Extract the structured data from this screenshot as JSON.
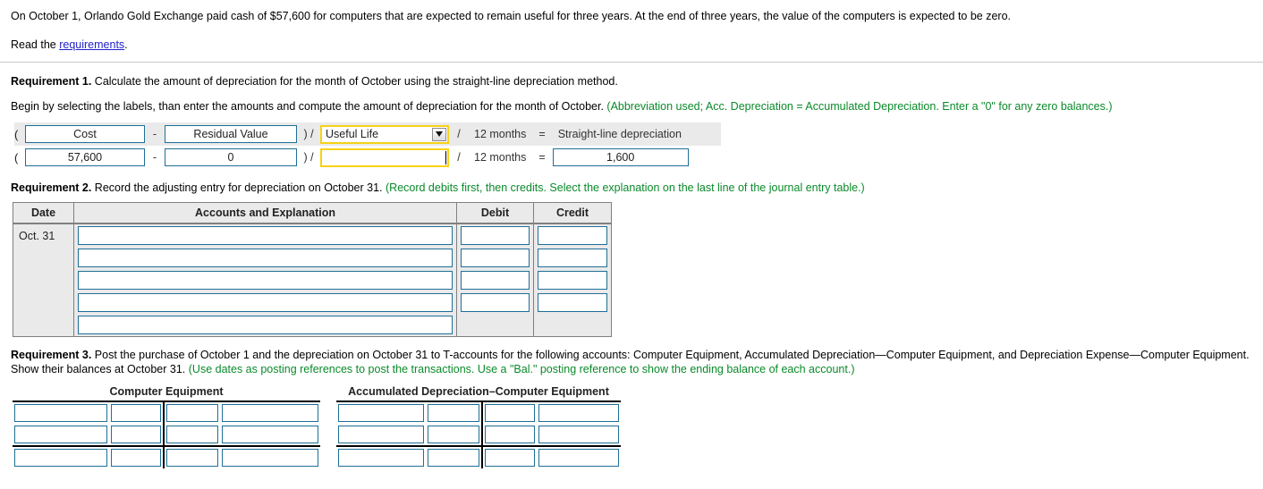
{
  "intro": {
    "paragraph": "On October 1, Orlando Gold Exchange paid cash of $57,600 for computers that are expected to remain useful for three years. At the end of three years, the value of the computers is expected to be zero.",
    "read_prefix": "Read the ",
    "link_text": "requirements",
    "read_suffix": "."
  },
  "requirement1": {
    "label": "Requirement 1.",
    "text": " Calculate the amount of depreciation for the month of October using the straight-line depreciation method.",
    "instruction_label": "Begin by selecting the labels, than enter the amounts and compute the amount of depreciation for the month of October.",
    "instruction_note": "(Abbreviation used; Acc. Depreciation = Accumulated Depreciation. Enter a \"0\" for any zero balances.)",
    "formula": {
      "open_paren": "(",
      "minus": "-",
      "close_paren_divide": ") /",
      "divide": "/",
      "equals": "=",
      "label_cost": "Cost",
      "label_residual": "Residual Value",
      "label_useful_life": "Useful Life",
      "label_months": "12 months",
      "label_result": "Straight-line depreciation",
      "value_cost": "57,600",
      "value_residual": "0",
      "value_useful_life": "",
      "value_months": "12 months",
      "value_result": "1,600"
    }
  },
  "requirement2": {
    "label": "Requirement 2.",
    "text": " Record the adjusting entry for depreciation on October 31.",
    "note": "(Record debits first, then credits. Select the explanation on the last line of the journal entry table.)",
    "table": {
      "headers": [
        "Date",
        "Accounts and Explanation",
        "Debit",
        "Credit"
      ],
      "date": "Oct. 31",
      "rows": [
        {
          "account": "",
          "debit": "",
          "credit": "",
          "has_amounts": true
        },
        {
          "account": "",
          "debit": "",
          "credit": "",
          "has_amounts": true
        },
        {
          "account": "",
          "debit": "",
          "credit": "",
          "has_amounts": true
        },
        {
          "account": "",
          "debit": "",
          "credit": "",
          "has_amounts": true
        },
        {
          "account": "",
          "debit": "",
          "credit": "",
          "has_amounts": false
        }
      ]
    }
  },
  "requirement3": {
    "label": "Requirement 3.",
    "text": " Post the purchase of October 1 and the depreciation on October 31 to T-accounts for the following accounts: Computer Equipment, Accumulated Depreciation—Computer Equipment, and Depreciation Expense—Computer Equipment. Show their balances at October 31.",
    "note": "(Use dates as posting references to post the transactions. Use a \"Bal.\" posting reference to show the ending balance of each account.)",
    "t_accounts": [
      {
        "title": "Computer Equipment",
        "rows": [
          {
            "left_ref": "",
            "left_amt": "",
            "right_amt": "",
            "right_ref": "",
            "is_balance": false
          },
          {
            "left_ref": "",
            "left_amt": "",
            "right_amt": "",
            "right_ref": "",
            "is_balance": false
          },
          {
            "left_ref": "",
            "left_amt": "",
            "right_amt": "",
            "right_ref": "",
            "is_balance": true
          }
        ]
      },
      {
        "title": "Accumulated Depreciation–Computer Equipment",
        "rows": [
          {
            "left_ref": "",
            "left_amt": "",
            "right_amt": "",
            "right_ref": "",
            "is_balance": false
          },
          {
            "left_ref": "",
            "left_amt": "",
            "right_amt": "",
            "right_ref": "",
            "is_balance": false
          },
          {
            "left_ref": "",
            "left_amt": "",
            "right_amt": "",
            "right_ref": "",
            "is_balance": true
          }
        ]
      }
    ]
  },
  "colors": {
    "input_border": "#1f6f96",
    "focus_border": "#f7d117",
    "note_green": "#0a8a2a",
    "link_blue": "#2222cc",
    "header_gray": "#eaeaea"
  }
}
